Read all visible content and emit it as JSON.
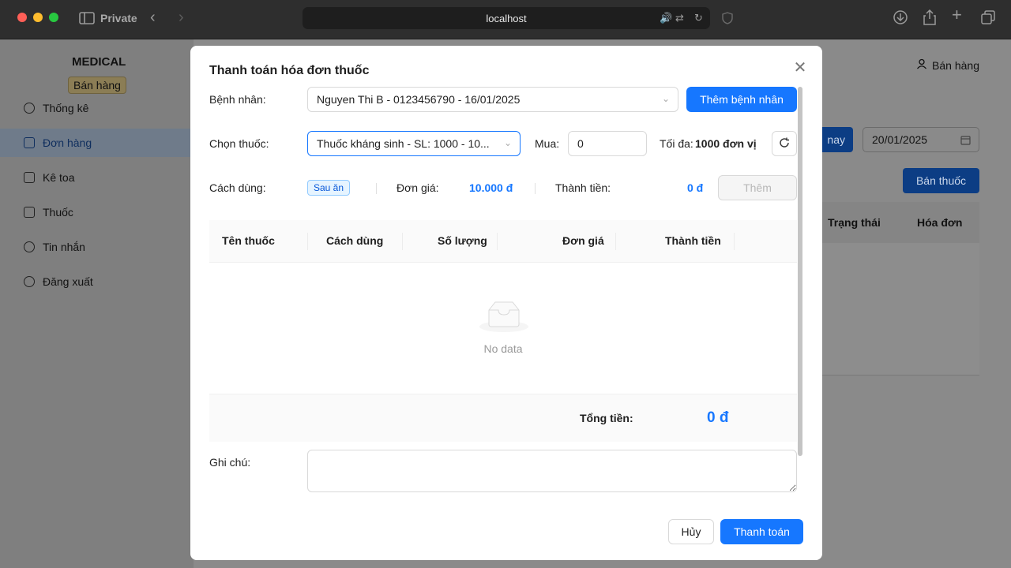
{
  "browser": {
    "mode_label": "Private",
    "url": "localhost"
  },
  "app": {
    "brand": "MEDICAL",
    "role_badge": "Bán hàng",
    "user_label": "Bán hàng",
    "nav": [
      {
        "label": "Thống kê",
        "icon": "dashboard-icon"
      },
      {
        "label": "Đơn hàng",
        "icon": "cart-icon",
        "active": true
      },
      {
        "label": "Kê toa",
        "icon": "bag-icon"
      },
      {
        "label": "Thuốc",
        "icon": "medicine-box-icon"
      },
      {
        "label": "Tin nhắn",
        "icon": "message-icon"
      },
      {
        "label": "Đăng xuất",
        "icon": "logout-icon"
      }
    ],
    "today_button_partial": "nay",
    "date_filter_value": "20/01/2025",
    "sell_button": "Bán thuốc",
    "table_headers": [
      "Trạng thái",
      "Hóa đơn"
    ]
  },
  "modal": {
    "title": "Thanh toán hóa đơn thuốc",
    "patient_label": "Bệnh nhân:",
    "patient_value": "Nguyen Thi B - 0123456790 - 16/01/2025",
    "add_patient_button": "Thêm bệnh nhân",
    "medicine_label": "Chọn thuốc:",
    "medicine_value": "Thuốc kháng sinh - SL: 1000 - 10...",
    "buy_label": "Mua:",
    "buy_value": "0",
    "max_label": "Tối đa:",
    "max_value": "1000 đơn vị",
    "usage_label": "Cách dùng:",
    "usage_tag": "Sau ăn",
    "unit_price_label": "Đơn giá:",
    "unit_price_value": "10.000 đ",
    "subtotal_label": "Thành tiền:",
    "subtotal_value": "0 đ",
    "add_button": "Thêm",
    "columns": [
      "Tên thuốc",
      "Cách dùng",
      "Số lượng",
      "Đơn giá",
      "Thành tiền"
    ],
    "empty_text": "No data",
    "total_label": "Tổng tiền:",
    "total_value": "0 đ",
    "note_label": "Ghi chú:",
    "cancel_button": "Hủy",
    "pay_button": "Thanh toán"
  },
  "colors": {
    "primary": "#1677ff",
    "tag_bg": "#e6f4ff"
  }
}
